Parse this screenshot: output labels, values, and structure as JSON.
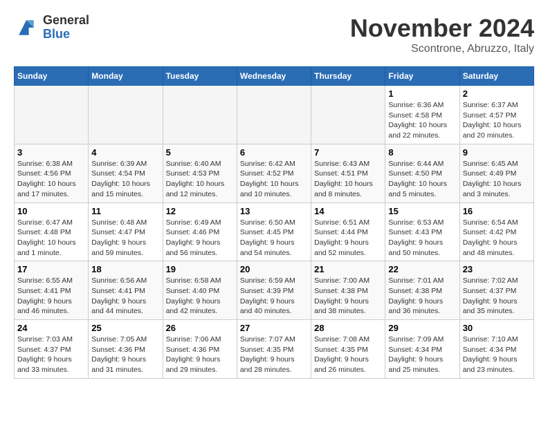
{
  "header": {
    "logo_line1": "General",
    "logo_line2": "Blue",
    "month": "November 2024",
    "location": "Scontrone, Abruzzo, Italy"
  },
  "weekdays": [
    "Sunday",
    "Monday",
    "Tuesday",
    "Wednesday",
    "Thursday",
    "Friday",
    "Saturday"
  ],
  "weeks": [
    [
      {
        "day": "",
        "empty": true
      },
      {
        "day": "",
        "empty": true
      },
      {
        "day": "",
        "empty": true
      },
      {
        "day": "",
        "empty": true
      },
      {
        "day": "",
        "empty": true
      },
      {
        "day": "1",
        "sunrise": "6:36 AM",
        "sunset": "4:58 PM",
        "daylight": "10 hours and 22 minutes."
      },
      {
        "day": "2",
        "sunrise": "6:37 AM",
        "sunset": "4:57 PM",
        "daylight": "10 hours and 20 minutes."
      }
    ],
    [
      {
        "day": "3",
        "sunrise": "6:38 AM",
        "sunset": "4:56 PM",
        "daylight": "10 hours and 17 minutes."
      },
      {
        "day": "4",
        "sunrise": "6:39 AM",
        "sunset": "4:54 PM",
        "daylight": "10 hours and 15 minutes."
      },
      {
        "day": "5",
        "sunrise": "6:40 AM",
        "sunset": "4:53 PM",
        "daylight": "10 hours and 12 minutes."
      },
      {
        "day": "6",
        "sunrise": "6:42 AM",
        "sunset": "4:52 PM",
        "daylight": "10 hours and 10 minutes."
      },
      {
        "day": "7",
        "sunrise": "6:43 AM",
        "sunset": "4:51 PM",
        "daylight": "10 hours and 8 minutes."
      },
      {
        "day": "8",
        "sunrise": "6:44 AM",
        "sunset": "4:50 PM",
        "daylight": "10 hours and 5 minutes."
      },
      {
        "day": "9",
        "sunrise": "6:45 AM",
        "sunset": "4:49 PM",
        "daylight": "10 hours and 3 minutes."
      }
    ],
    [
      {
        "day": "10",
        "sunrise": "6:47 AM",
        "sunset": "4:48 PM",
        "daylight": "10 hours and 1 minute."
      },
      {
        "day": "11",
        "sunrise": "6:48 AM",
        "sunset": "4:47 PM",
        "daylight": "9 hours and 59 minutes."
      },
      {
        "day": "12",
        "sunrise": "6:49 AM",
        "sunset": "4:46 PM",
        "daylight": "9 hours and 56 minutes."
      },
      {
        "day": "13",
        "sunrise": "6:50 AM",
        "sunset": "4:45 PM",
        "daylight": "9 hours and 54 minutes."
      },
      {
        "day": "14",
        "sunrise": "6:51 AM",
        "sunset": "4:44 PM",
        "daylight": "9 hours and 52 minutes."
      },
      {
        "day": "15",
        "sunrise": "6:53 AM",
        "sunset": "4:43 PM",
        "daylight": "9 hours and 50 minutes."
      },
      {
        "day": "16",
        "sunrise": "6:54 AM",
        "sunset": "4:42 PM",
        "daylight": "9 hours and 48 minutes."
      }
    ],
    [
      {
        "day": "17",
        "sunrise": "6:55 AM",
        "sunset": "4:41 PM",
        "daylight": "9 hours and 46 minutes."
      },
      {
        "day": "18",
        "sunrise": "6:56 AM",
        "sunset": "4:41 PM",
        "daylight": "9 hours and 44 minutes."
      },
      {
        "day": "19",
        "sunrise": "6:58 AM",
        "sunset": "4:40 PM",
        "daylight": "9 hours and 42 minutes."
      },
      {
        "day": "20",
        "sunrise": "6:59 AM",
        "sunset": "4:39 PM",
        "daylight": "9 hours and 40 minutes."
      },
      {
        "day": "21",
        "sunrise": "7:00 AM",
        "sunset": "4:38 PM",
        "daylight": "9 hours and 38 minutes."
      },
      {
        "day": "22",
        "sunrise": "7:01 AM",
        "sunset": "4:38 PM",
        "daylight": "9 hours and 36 minutes."
      },
      {
        "day": "23",
        "sunrise": "7:02 AM",
        "sunset": "4:37 PM",
        "daylight": "9 hours and 35 minutes."
      }
    ],
    [
      {
        "day": "24",
        "sunrise": "7:03 AM",
        "sunset": "4:37 PM",
        "daylight": "9 hours and 33 minutes."
      },
      {
        "day": "25",
        "sunrise": "7:05 AM",
        "sunset": "4:36 PM",
        "daylight": "9 hours and 31 minutes."
      },
      {
        "day": "26",
        "sunrise": "7:06 AM",
        "sunset": "4:36 PM",
        "daylight": "9 hours and 29 minutes."
      },
      {
        "day": "27",
        "sunrise": "7:07 AM",
        "sunset": "4:35 PM",
        "daylight": "9 hours and 28 minutes."
      },
      {
        "day": "28",
        "sunrise": "7:08 AM",
        "sunset": "4:35 PM",
        "daylight": "9 hours and 26 minutes."
      },
      {
        "day": "29",
        "sunrise": "7:09 AM",
        "sunset": "4:34 PM",
        "daylight": "9 hours and 25 minutes."
      },
      {
        "day": "30",
        "sunrise": "7:10 AM",
        "sunset": "4:34 PM",
        "daylight": "9 hours and 23 minutes."
      }
    ]
  ],
  "labels": {
    "sunrise": "Sunrise:",
    "sunset": "Sunset:",
    "daylight": "Daylight:"
  }
}
